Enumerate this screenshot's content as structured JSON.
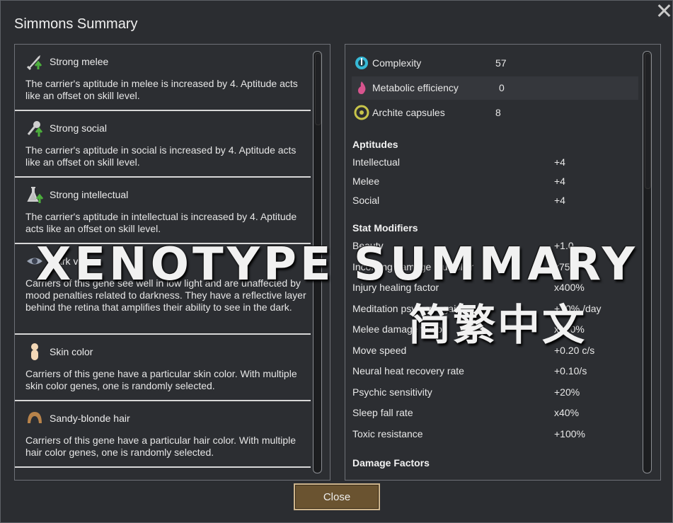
{
  "window": {
    "title": "Simmons Summary",
    "close_icon": "close-x-icon"
  },
  "genes": [
    {
      "name": "Strong melee",
      "icon": "sword-arrow-icon",
      "desc": "The carrier's aptitude in melee is increased by 4. Aptitude acts like an offset on skill level."
    },
    {
      "name": "Strong social",
      "icon": "microphone-arrow-icon",
      "desc": "The carrier's aptitude in social is increased by 4. Aptitude acts like an offset on skill level."
    },
    {
      "name": "Strong intellectual",
      "icon": "flask-arrow-icon",
      "desc": "The carrier's aptitude in intellectual is increased by 4. Aptitude acts like an offset on skill level."
    },
    {
      "name": "Dark vision",
      "icon": "eye-icon",
      "desc": "Carriers of this gene see well in low light and are unaffected by mood penalties related to darkness. They have a reflective layer behind the retina that amplifies their ability to see in the dark."
    },
    {
      "name": "Skin color",
      "icon": "skin-figure-icon",
      "desc": "Carriers of this gene have a particular skin color. With multiple skin color genes, one is randomly selected."
    },
    {
      "name": "Sandy-blonde hair",
      "icon": "hair-icon",
      "desc": "Carriers of this gene have a particular hair color. With multiple hair color genes, one is randomly selected."
    }
  ],
  "stats": [
    {
      "label": "Complexity",
      "value": "57",
      "icon": "complexity-icon",
      "color": "#37b9d6"
    },
    {
      "label": "Metabolic efficiency",
      "value": "0",
      "icon": "metabolic-flame-icon",
      "color": "#d8548e"
    },
    {
      "label": "Archite capsules",
      "value": "8",
      "icon": "archite-capsule-icon",
      "color": "#c7c44a"
    }
  ],
  "aptitudes": {
    "heading": "Aptitudes",
    "items": [
      {
        "k": "Intellectual",
        "v": "+4"
      },
      {
        "k": "Melee",
        "v": "+4"
      },
      {
        "k": "Social",
        "v": "+4"
      }
    ]
  },
  "stat_modifiers": {
    "heading": "Stat Modifiers",
    "items": [
      {
        "k": "Beauty",
        "v": "+1.0"
      },
      {
        "k": "Incoming damage multiplier",
        "v": "x75%"
      },
      {
        "k": "Injury healing factor",
        "v": "x400%"
      },
      {
        "k": "Meditation psyfocus gain",
        "v": "+10% /day"
      },
      {
        "k": "Melee damage factor",
        "v": "x150%"
      },
      {
        "k": "Move speed",
        "v": "+0.20 c/s"
      },
      {
        "k": "Neural heat recovery rate",
        "v": "+0.10/s"
      },
      {
        "k": "Psychic sensitivity",
        "v": "+20%"
      },
      {
        "k": "Sleep fall rate",
        "v": "x40%"
      },
      {
        "k": "Toxic resistance",
        "v": "+100%"
      }
    ]
  },
  "damage_factors": {
    "heading": "Damage Factors"
  },
  "close_button": "Close",
  "watermark": {
    "title": "XENOTYPE SUMMARY",
    "subtitle": "简繁中文"
  }
}
